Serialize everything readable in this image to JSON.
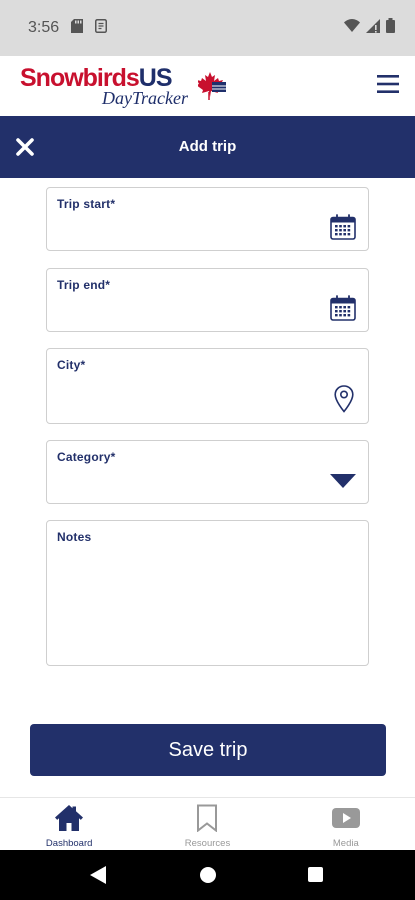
{
  "status_bar": {
    "time": "3:56"
  },
  "header": {
    "logo_main": "Snowbirds",
    "logo_accent": "US",
    "logo_sub": "DayTracker",
    "menu_icon": "hamburger-menu-icon"
  },
  "title_bar": {
    "title": "Add trip",
    "close_icon": "close-x-icon"
  },
  "form": {
    "trip_start": {
      "label": "Trip start*",
      "icon": "calendar-icon"
    },
    "trip_end": {
      "label": "Trip end*",
      "icon": "calendar-icon"
    },
    "city": {
      "label": "City*",
      "icon": "location-pin-icon"
    },
    "category": {
      "label": "Category*",
      "icon": "dropdown-triangle-icon"
    },
    "notes": {
      "label": "Notes"
    }
  },
  "save_button": {
    "label": "Save trip"
  },
  "bottom_nav": {
    "items": [
      {
        "label": "Dashboard",
        "icon": "home-icon",
        "active": true
      },
      {
        "label": "Resources",
        "icon": "bookmark-icon",
        "active": false
      },
      {
        "label": "Media",
        "icon": "play-video-icon",
        "active": false
      }
    ]
  },
  "colors": {
    "primary": "#22306a",
    "brand_red": "#c8102e",
    "border": "#cfcfcf",
    "inactive": "#999999"
  }
}
